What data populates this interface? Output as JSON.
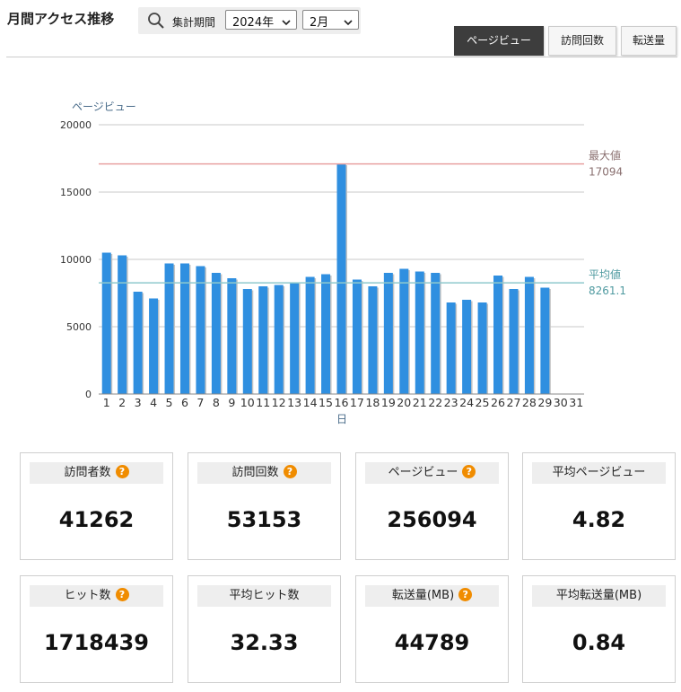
{
  "header": {
    "title": "月間アクセス推移",
    "period_label": "集計期間",
    "year_value": "2024年",
    "month_value": "2月"
  },
  "tabs": [
    {
      "label": "ページビュー",
      "active": true
    },
    {
      "label": "訪問回数",
      "active": false
    },
    {
      "label": "転送量",
      "active": false
    }
  ],
  "chart_data": {
    "type": "bar",
    "ylabel": "ページビュー",
    "xlabel": "日",
    "ylim": [
      0,
      20000
    ],
    "yticks": [
      0,
      5000,
      10000,
      15000,
      20000
    ],
    "categories": [
      "1",
      "2",
      "3",
      "4",
      "5",
      "6",
      "7",
      "8",
      "9",
      "10",
      "11",
      "12",
      "13",
      "14",
      "15",
      "16",
      "17",
      "18",
      "19",
      "20",
      "21",
      "22",
      "23",
      "24",
      "25",
      "26",
      "27",
      "28",
      "29",
      "30",
      "31"
    ],
    "series": [
      {
        "values": [
          10500,
          10300,
          7600,
          7100,
          9700,
          9700,
          9500,
          9000,
          8600,
          7800,
          8000,
          8100,
          8300,
          8700,
          8900,
          17094,
          8500,
          8000,
          9000,
          9300,
          9100,
          9000,
          6800,
          7000,
          6800,
          8800,
          7800,
          8700,
          7900,
          null,
          null
        ]
      }
    ],
    "reference_lines": [
      {
        "label": "最大値",
        "value": 17094,
        "value_text": "17094",
        "color": "#e8a2a2",
        "text_color": "#8a7070"
      },
      {
        "label": "平均値",
        "value": 8261.1,
        "value_text": "8261.1",
        "color": "#8fc9cd",
        "text_color": "#4f9aa0"
      }
    ],
    "bar_color": "#2f8fe0",
    "grid": true
  },
  "cards_row1": [
    {
      "label": "訪問者数",
      "value": "41262",
      "help": true
    },
    {
      "label": "訪問回数",
      "value": "53153",
      "help": true
    },
    {
      "label": "ページビュー",
      "value": "256094",
      "help": true
    },
    {
      "label": "平均ページビュー",
      "value": "4.82",
      "help": false
    }
  ],
  "cards_row2": [
    {
      "label": "ヒット数",
      "value": "1718439",
      "help": true
    },
    {
      "label": "平均ヒット数",
      "value": "32.33",
      "help": false
    },
    {
      "label": "転送量(MB)",
      "value": "44789",
      "help": true
    },
    {
      "label": "平均転送量(MB)",
      "value": "0.84",
      "help": false
    }
  ],
  "help_glyph": "?",
  "colors": {
    "accent_help": "#f08c00",
    "tab_active": "#3d3d3d"
  }
}
